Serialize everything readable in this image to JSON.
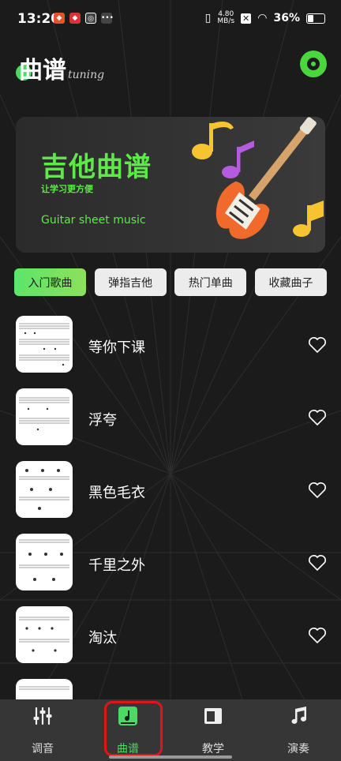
{
  "status_bar": {
    "time": "13:20",
    "speed": "4.80\nMB/s",
    "battery": "36%"
  },
  "header": {
    "logo_text": "曲谱",
    "logo_sub": "tuning"
  },
  "banner": {
    "title": "吉他曲谱",
    "subtitle": "让学习更方便",
    "english": "Guitar sheet music"
  },
  "tabs": [
    {
      "label": "入门歌曲",
      "active": true
    },
    {
      "label": "弹指吉他",
      "active": false
    },
    {
      "label": "热门单曲",
      "active": false
    },
    {
      "label": "收藏曲子",
      "active": false
    }
  ],
  "songs": [
    {
      "title": "等你下课"
    },
    {
      "title": "浮夸"
    },
    {
      "title": "黑色毛衣"
    },
    {
      "title": "千里之外"
    },
    {
      "title": "淘汰"
    }
  ],
  "nav": [
    {
      "label": "调音",
      "icon": "sliders-icon"
    },
    {
      "label": "曲谱",
      "icon": "music-note-square-icon"
    },
    {
      "label": "教学",
      "icon": "book-icon"
    },
    {
      "label": "演奏",
      "icon": "music-note-icon"
    }
  ],
  "colors": {
    "accent": "#4cd964",
    "banner_text": "#5fe84a",
    "highlight": "#e01616"
  }
}
